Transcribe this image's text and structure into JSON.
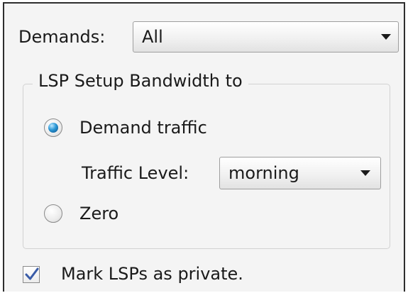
{
  "demands": {
    "label": "Demands:",
    "selected": "All"
  },
  "lsp_group": {
    "title": "LSP Setup Bandwidth to",
    "options": [
      {
        "label": "Demand traffic",
        "checked": true
      },
      {
        "label": "Zero",
        "checked": false
      }
    ],
    "traffic_level": {
      "label": "Traffic Level:",
      "selected": "morning"
    }
  },
  "mark_private": {
    "label": "Mark LSPs as private.",
    "checked": true
  },
  "icons": {
    "dropdown": "chevron-down-icon",
    "checkmark": "checkmark-icon"
  },
  "colors": {
    "radio_selected": "#2a97d6",
    "checkmark": "#3a5ca8",
    "panel_background": "#f4f4f4"
  }
}
